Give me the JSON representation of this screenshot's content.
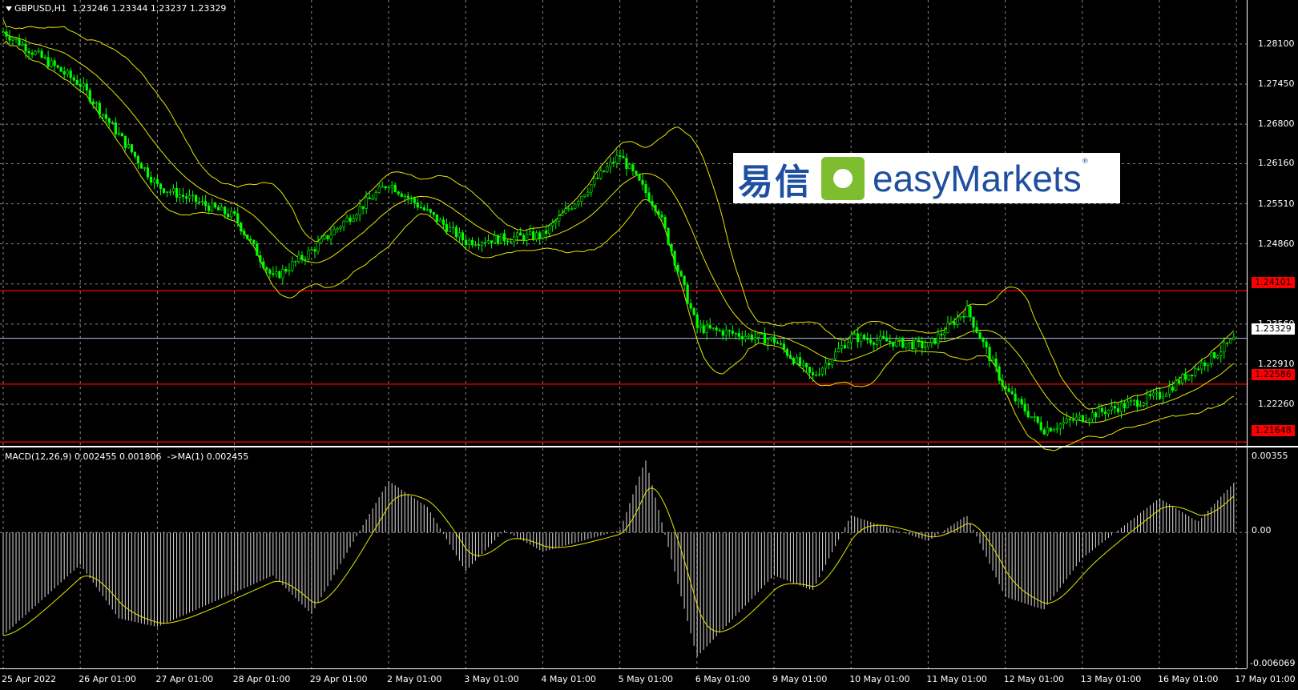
{
  "symbol_header": "GBPUSD,H1  1.23246 1.23344 1.23237 1.23329",
  "macd_header": "MACD(12,26,9) 0.002455 0.001806  ->MA(1) 0.002455",
  "price_axis": [
    "1.28100",
    "1.27450",
    "1.26800",
    "1.26160",
    "1.25510",
    "1.24860",
    "1.24210",
    "1.23560",
    "1.22910",
    "1.22260"
  ],
  "price_tags": {
    "level1": "1.24101",
    "current": "1.23329",
    "level2": "1.22586",
    "level3": "1.21648"
  },
  "macd_axis": {
    "top": "0.00355",
    "zero": "0.00",
    "bottom": "-0.006069"
  },
  "time_axis": [
    "25 Apr 2022",
    "26 Apr 01:00",
    "27 Apr 01:00",
    "28 Apr 01:00",
    "29 Apr 01:00",
    "2 May 01:00",
    "3 May 01:00",
    "4 May 01:00",
    "5 May 01:00",
    "6 May 01:00",
    "9 May 01:00",
    "10 May 01:00",
    "11 May 01:00",
    "12 May 01:00",
    "13 May 01:00",
    "16 May 01:00",
    "17 May 01:00"
  ],
  "logo": {
    "cn": "易信",
    "en": "easyMarkets",
    "reg": "®"
  },
  "colors": {
    "candle": "#00ff00",
    "bands": "#e6e600",
    "level": "#ff0000",
    "grid": "#8a8a8a",
    "macd_signal": "#e6e600",
    "macd_hist": "#c8c8c8"
  },
  "chart_data": {
    "type": "line",
    "title": "GBPUSD,H1",
    "ohlc_last": {
      "open": 1.23246,
      "high": 1.23344,
      "low": 1.23237,
      "close": 1.23329
    },
    "price_ylim": [
      1.2165,
      1.2858
    ],
    "horizontal_levels": [
      1.24101,
      1.22586,
      1.21648
    ],
    "current_price": 1.23329,
    "close_keypoints": [
      {
        "x": "25 Apr 2022",
        "y": 1.283
      },
      {
        "x": "26 Apr 01:00",
        "y": 1.2745
      },
      {
        "x": "27 Apr 01:00",
        "y": 1.258
      },
      {
        "x": "28 Apr 01:00",
        "y": 1.253
      },
      {
        "x": "28 Apr 13:00",
        "y": 1.243
      },
      {
        "x": "29 Apr 01:00",
        "y": 1.2475
      },
      {
        "x": "2 May 01:00",
        "y": 1.2585
      },
      {
        "x": "3 May 01:00",
        "y": 1.249
      },
      {
        "x": "4 May 01:00",
        "y": 1.25
      },
      {
        "x": "5 May 01:00",
        "y": 1.263
      },
      {
        "x": "5 May 13:00",
        "y": 1.254
      },
      {
        "x": "6 May 01:00",
        "y": 1.235
      },
      {
        "x": "9 May 01:00",
        "y": 1.233
      },
      {
        "x": "9 May 13:00",
        "y": 1.227
      },
      {
        "x": "10 May 01:00",
        "y": 1.2335
      },
      {
        "x": "11 May 01:00",
        "y": 1.232
      },
      {
        "x": "11 May 13:00",
        "y": 1.238
      },
      {
        "x": "12 May 01:00",
        "y": 1.225
      },
      {
        "x": "12 May 13:00",
        "y": 1.2185
      },
      {
        "x": "13 May 01:00",
        "y": 1.2205
      },
      {
        "x": "16 May 01:00",
        "y": 1.224
      },
      {
        "x": "17 May 01:00",
        "y": 1.23329
      }
    ],
    "macd": {
      "name": "MACD(12,26,9)",
      "main": 0.002455,
      "signal": 0.001806,
      "ylim": [
        -0.006069,
        0.00355
      ],
      "hist_keypoints": [
        {
          "x": "25 Apr 2022",
          "y": -0.0048
        },
        {
          "x": "26 Apr 01:00",
          "y": -0.0015
        },
        {
          "x": "26 Apr 13:00",
          "y": -0.004
        },
        {
          "x": "27 Apr 01:00",
          "y": -0.0044
        },
        {
          "x": "28 Apr 01:00",
          "y": -0.0028
        },
        {
          "x": "28 Apr 13:00",
          "y": -0.002
        },
        {
          "x": "29 Apr 01:00",
          "y": -0.0038
        },
        {
          "x": "2 May 01:00",
          "y": 0.0024
        },
        {
          "x": "2 May 13:00",
          "y": 0.0012
        },
        {
          "x": "3 May 01:00",
          "y": -0.0018
        },
        {
          "x": "3 May 13:00",
          "y": 0.0001
        },
        {
          "x": "4 May 01:00",
          "y": -0.0009
        },
        {
          "x": "5 May 01:00",
          "y": 0.0001
        },
        {
          "x": "5 May 09:00",
          "y": 0.0034
        },
        {
          "x": "6 May 01:00",
          "y": -0.0058
        },
        {
          "x": "9 May 01:00",
          "y": -0.002
        },
        {
          "x": "9 May 13:00",
          "y": -0.0027
        },
        {
          "x": "10 May 01:00",
          "y": 0.0008
        },
        {
          "x": "11 May 01:00",
          "y": -0.0004
        },
        {
          "x": "11 May 13:00",
          "y": 0.0008
        },
        {
          "x": "12 May 01:00",
          "y": -0.003
        },
        {
          "x": "12 May 13:00",
          "y": -0.0036
        },
        {
          "x": "13 May 01:00",
          "y": -0.0012
        },
        {
          "x": "16 May 01:00",
          "y": 0.0016
        },
        {
          "x": "16 May 13:00",
          "y": 0.0005
        },
        {
          "x": "17 May 01:00",
          "y": 0.002455
        }
      ]
    }
  }
}
